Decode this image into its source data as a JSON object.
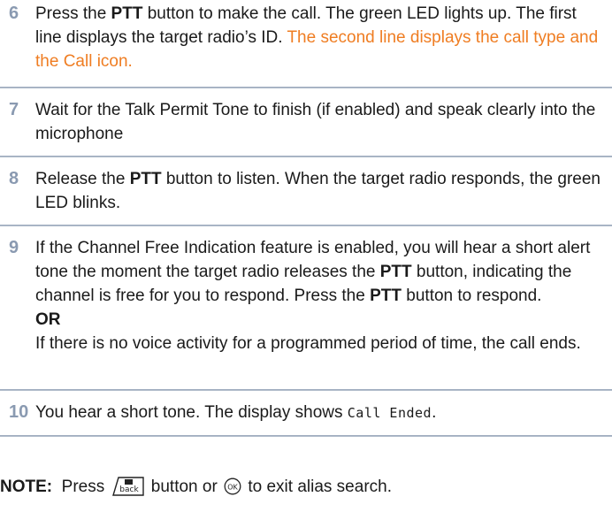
{
  "steps": [
    {
      "number": "6",
      "parts": [
        {
          "t": "Press the "
        },
        {
          "b": "PTT"
        },
        {
          "t": " button to make the call. The green LED lights up. The first line displays the target radio’s ID. "
        },
        {
          "o": "The second line displays the call type and the Call icon."
        }
      ]
    },
    {
      "number": "7",
      "parts": [
        {
          "t": "Wait for the Talk Permit Tone to finish (if enabled) and speak clearly into the microphone"
        }
      ]
    },
    {
      "number": "8",
      "parts": [
        {
          "t": "Release the "
        },
        {
          "b": "PTT"
        },
        {
          "t": " button to listen. When the target radio responds, the green LED blinks."
        }
      ]
    },
    {
      "number": "9",
      "parts": [
        {
          "t": "If the Channel Free Indication feature is enabled, you will hear a short alert tone the moment the target radio releases the "
        },
        {
          "b": "PTT"
        },
        {
          "t": " button, indicating the channel is free for you to respond. Press the "
        },
        {
          "b": "PTT"
        },
        {
          "t": " button to respond."
        },
        {
          "br": true
        },
        {
          "b": "OR"
        },
        {
          "br": true
        },
        {
          "t": "If there is no voice activity for a programmed period of time, the call ends."
        }
      ]
    },
    {
      "number": "10",
      "parts": [
        {
          "t": "You hear a short tone. The display shows "
        },
        {
          "m": "Call Ended"
        },
        {
          "t": "."
        }
      ]
    }
  ],
  "note": {
    "label": "NOTE:",
    "text_before": "  Press ",
    "key_back_label": "back",
    "text_middle": " button or ",
    "key_ok_label": "OK",
    "text_after": " to exit alias search."
  },
  "colors": {
    "step_number": "#8a9ab1",
    "highlight": "#ef7d22",
    "rule": "#9aa7bb"
  }
}
